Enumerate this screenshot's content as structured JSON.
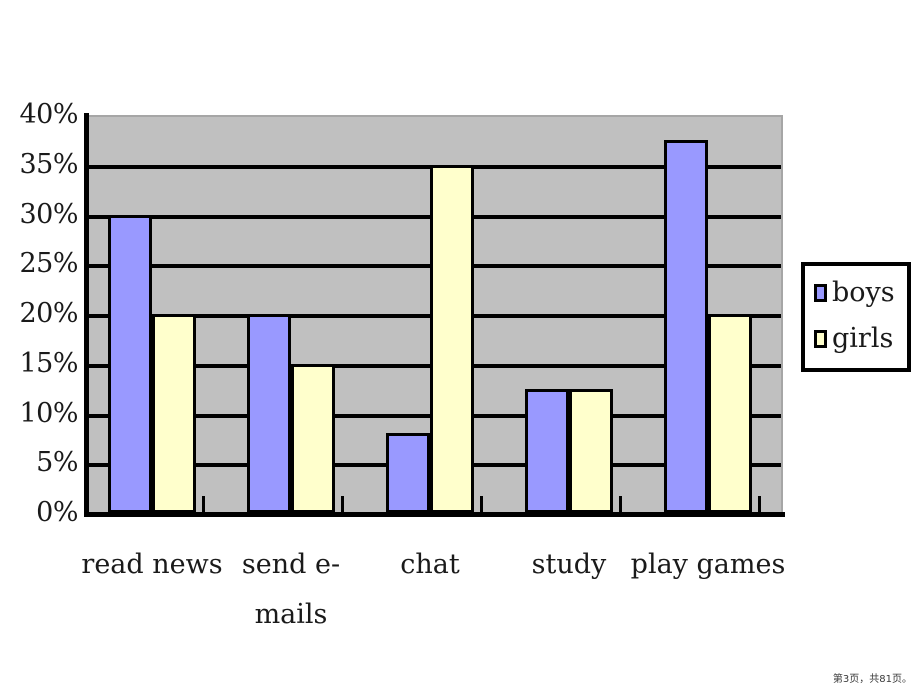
{
  "chart_data": {
    "type": "bar",
    "title": "",
    "subtitle": "",
    "xlabel": "",
    "ylabel": "",
    "categories": [
      "read news",
      "send e-\nmails",
      "chat",
      "study",
      "play games"
    ],
    "series": [
      {
        "name": "boys",
        "color": "#9999FF",
        "values": [
          30,
          20,
          8,
          12.5,
          37.5
        ]
      },
      {
        "name": "girls",
        "color": "#FFFFCC",
        "values": [
          20,
          15,
          35,
          12.5,
          20
        ]
      }
    ],
    "ylim": [
      0,
      40
    ],
    "ytick_step": 5,
    "ytick_labels": [
      "0%",
      "5%",
      "10%",
      "15%",
      "20%",
      "25%",
      "30%",
      "35%",
      "40%"
    ],
    "ytick_values": [
      0,
      5,
      10,
      15,
      20,
      25,
      30,
      35,
      40
    ],
    "grid": true,
    "grid_axis": "y",
    "legend_position": "right",
    "plot_background": "#C0C0C0",
    "figure_background": "#FFFFFF",
    "gridline_color": "#000000",
    "bar_border_color": "#000000"
  },
  "legend": {
    "entries": [
      {
        "label": "boys",
        "color": "#9999FF"
      },
      {
        "label": "girls",
        "color": "#FFFFCC"
      }
    ]
  },
  "footer": {
    "page_text": "第3页，共81页。"
  }
}
